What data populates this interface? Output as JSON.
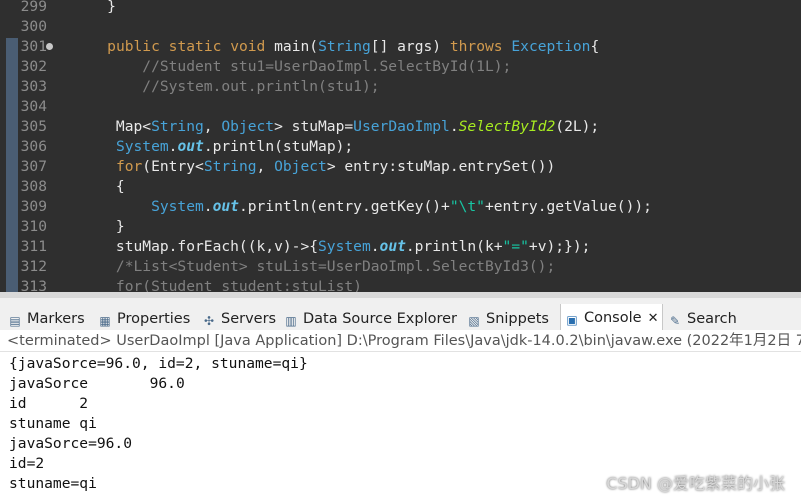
{
  "editor": {
    "lines": [
      {
        "no": "299",
        "tokens": [
          {
            "t": "    }",
            "c": "pl"
          }
        ]
      },
      {
        "no": "300",
        "tokens": []
      },
      {
        "no": "301",
        "fold": true,
        "tokens": [
          {
            "t": "    ",
            "c": "pl"
          },
          {
            "t": "public",
            "c": "kw"
          },
          {
            "t": " ",
            "c": "pl"
          },
          {
            "t": "static",
            "c": "kw"
          },
          {
            "t": " ",
            "c": "pl"
          },
          {
            "t": "void",
            "c": "kw"
          },
          {
            "t": " main(",
            "c": "pl"
          },
          {
            "t": "String",
            "c": "ty"
          },
          {
            "t": "[] args) ",
            "c": "pl"
          },
          {
            "t": "throws",
            "c": "kw"
          },
          {
            "t": " ",
            "c": "pl"
          },
          {
            "t": "Exception",
            "c": "ty"
          },
          {
            "t": "{",
            "c": "pl"
          }
        ]
      },
      {
        "no": "302",
        "tokens": [
          {
            "t": "        //Student stu1=UserDaoImpl.SelectById(1L);",
            "c": "cm"
          }
        ]
      },
      {
        "no": "303",
        "tokens": [
          {
            "t": "        //System.out.println(stu1);",
            "c": "cm"
          }
        ]
      },
      {
        "no": "304",
        "tokens": []
      },
      {
        "no": "305",
        "tokens": [
          {
            "t": "     Map<",
            "c": "pl"
          },
          {
            "t": "String",
            "c": "ty"
          },
          {
            "t": ", ",
            "c": "pl"
          },
          {
            "t": "Object",
            "c": "ty"
          },
          {
            "t": "> stuMap=",
            "c": "pl"
          },
          {
            "t": "UserDaoImpl",
            "c": "ty"
          },
          {
            "t": ".",
            "c": "pl"
          },
          {
            "t": "SelectById2",
            "c": "mt it"
          },
          {
            "t": "(2L);",
            "c": "pl"
          }
        ]
      },
      {
        "no": "306",
        "tokens": [
          {
            "t": "     ",
            "c": "pl"
          },
          {
            "t": "System",
            "c": "ty"
          },
          {
            "t": ".",
            "c": "pl"
          },
          {
            "t": "out",
            "c": "fl bi"
          },
          {
            "t": ".println(stuMap);",
            "c": "pl"
          }
        ]
      },
      {
        "no": "307",
        "tokens": [
          {
            "t": "     ",
            "c": "pl"
          },
          {
            "t": "for",
            "c": "kw"
          },
          {
            "t": "(Entry<",
            "c": "pl"
          },
          {
            "t": "String",
            "c": "ty"
          },
          {
            "t": ", ",
            "c": "pl"
          },
          {
            "t": "Object",
            "c": "ty"
          },
          {
            "t": "> entry:stuMap.entrySet())",
            "c": "pl"
          }
        ]
      },
      {
        "no": "308",
        "tokens": [
          {
            "t": "     {",
            "c": "pl"
          }
        ]
      },
      {
        "no": "309",
        "tokens": [
          {
            "t": "         ",
            "c": "pl"
          },
          {
            "t": "System",
            "c": "ty"
          },
          {
            "t": ".",
            "c": "pl"
          },
          {
            "t": "out",
            "c": "fl bi"
          },
          {
            "t": ".println(entry.getKey()+",
            "c": "pl"
          },
          {
            "t": "\"\\t\"",
            "c": "st"
          },
          {
            "t": "+entry.getValue());",
            "c": "pl"
          }
        ]
      },
      {
        "no": "310",
        "tokens": [
          {
            "t": "     }",
            "c": "pl"
          }
        ]
      },
      {
        "no": "311",
        "tokens": [
          {
            "t": "     stuMap.forEach((k,v)->{",
            "c": "pl"
          },
          {
            "t": "System",
            "c": "ty"
          },
          {
            "t": ".",
            "c": "pl"
          },
          {
            "t": "out",
            "c": "fl bi"
          },
          {
            "t": ".println(k+",
            "c": "pl"
          },
          {
            "t": "\"=\"",
            "c": "st"
          },
          {
            "t": "+v);});",
            "c": "pl"
          }
        ]
      },
      {
        "no": "312",
        "tokens": [
          {
            "t": "     /*List<Student> stuList=UserDaoImpl.SelectById3();",
            "c": "cm"
          }
        ]
      },
      {
        "no": "313",
        "tokens": [
          {
            "t": "     for(Student student:stuList)",
            "c": "cm"
          }
        ]
      }
    ]
  },
  "tabs": [
    {
      "label": "Markers",
      "icon": "markers-icon",
      "glyph": "▤"
    },
    {
      "label": "Properties",
      "icon": "properties-icon",
      "glyph": "▦"
    },
    {
      "label": "Servers",
      "icon": "servers-icon",
      "glyph": "✣"
    },
    {
      "label": "Data Source Explorer",
      "icon": "data-source-icon",
      "glyph": "▥"
    },
    {
      "label": "Snippets",
      "icon": "snippets-icon",
      "glyph": "▧"
    },
    {
      "label": "Console",
      "icon": "console-icon",
      "glyph": "▣",
      "active": true
    },
    {
      "label": "Search",
      "icon": "search-icon",
      "glyph": "✎"
    }
  ],
  "console": {
    "header": "<terminated> UserDaoImpl [Java Application] D:\\Program Files\\Java\\jdk-14.0.2\\bin\\javaw.exe (2022年1月2日 7",
    "output": [
      "{javaSorce=96.0, id=2, stuname=qi}",
      "javaSorce\t96.0",
      "id\t2",
      "stuname\tqi",
      "javaSorce=96.0",
      "id=2",
      "stuname=qi"
    ]
  },
  "watermark": "CSDN @爱吃紫菜的小张",
  "colors": {
    "editor_bg": "#2f2f2f",
    "keyword": "#d19a4e",
    "type": "#47a3d8",
    "comment": "#808080",
    "string": "#17c6a3",
    "method": "#a7ec21"
  }
}
